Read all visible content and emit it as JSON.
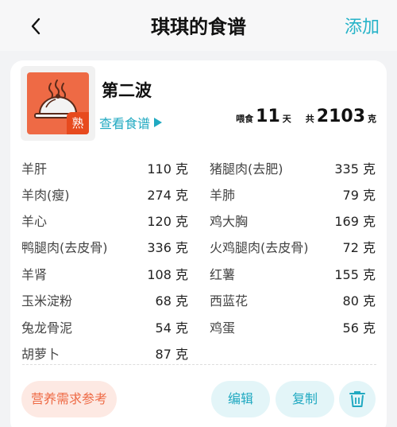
{
  "header": {
    "title": "琪琪的食谱",
    "add_label": "添加"
  },
  "recipe": {
    "name": "第二波",
    "badge": "熟",
    "view_label": "查看食谱",
    "feed_label": "喂食",
    "feed_days": "11",
    "days_unit": "天",
    "total_label": "共",
    "total_amount": "2103",
    "total_unit": "克"
  },
  "ingredients_left": [
    {
      "name": "羊肝",
      "amount": "110 克"
    },
    {
      "name": "羊肉(瘦)",
      "amount": "274 克"
    },
    {
      "name": "羊心",
      "amount": "120 克"
    },
    {
      "name": "鸭腿肉(去皮骨)",
      "amount": "336 克"
    },
    {
      "name": "羊肾",
      "amount": "108 克"
    },
    {
      "name": "玉米淀粉",
      "amount": "68 克"
    },
    {
      "name": "兔龙骨泥",
      "amount": "54 克"
    },
    {
      "name": "胡萝卜",
      "amount": "87 克"
    }
  ],
  "ingredients_right": [
    {
      "name": "猪腿肉(去肥)",
      "amount": "335 克"
    },
    {
      "name": "羊肺",
      "amount": "79 克"
    },
    {
      "name": "鸡大胸",
      "amount": "169 克"
    },
    {
      "name": "火鸡腿肉(去皮骨)",
      "amount": "72 克"
    },
    {
      "name": "红薯",
      "amount": "155 克"
    },
    {
      "name": "西蓝花",
      "amount": "80 克"
    },
    {
      "name": "鸡蛋",
      "amount": "56 克"
    }
  ],
  "actions": {
    "nutrition_ref": "营养需求参考",
    "edit": "编辑",
    "copy": "复制"
  },
  "icons": {
    "back": "chevron-left-icon",
    "view": "triangle-right-icon",
    "delete": "trash-icon",
    "thumb": "food-cloche-icon"
  },
  "colors": {
    "accent": "#20a9c1",
    "orange": "#ee6a45",
    "badge": "#e74a1e"
  }
}
